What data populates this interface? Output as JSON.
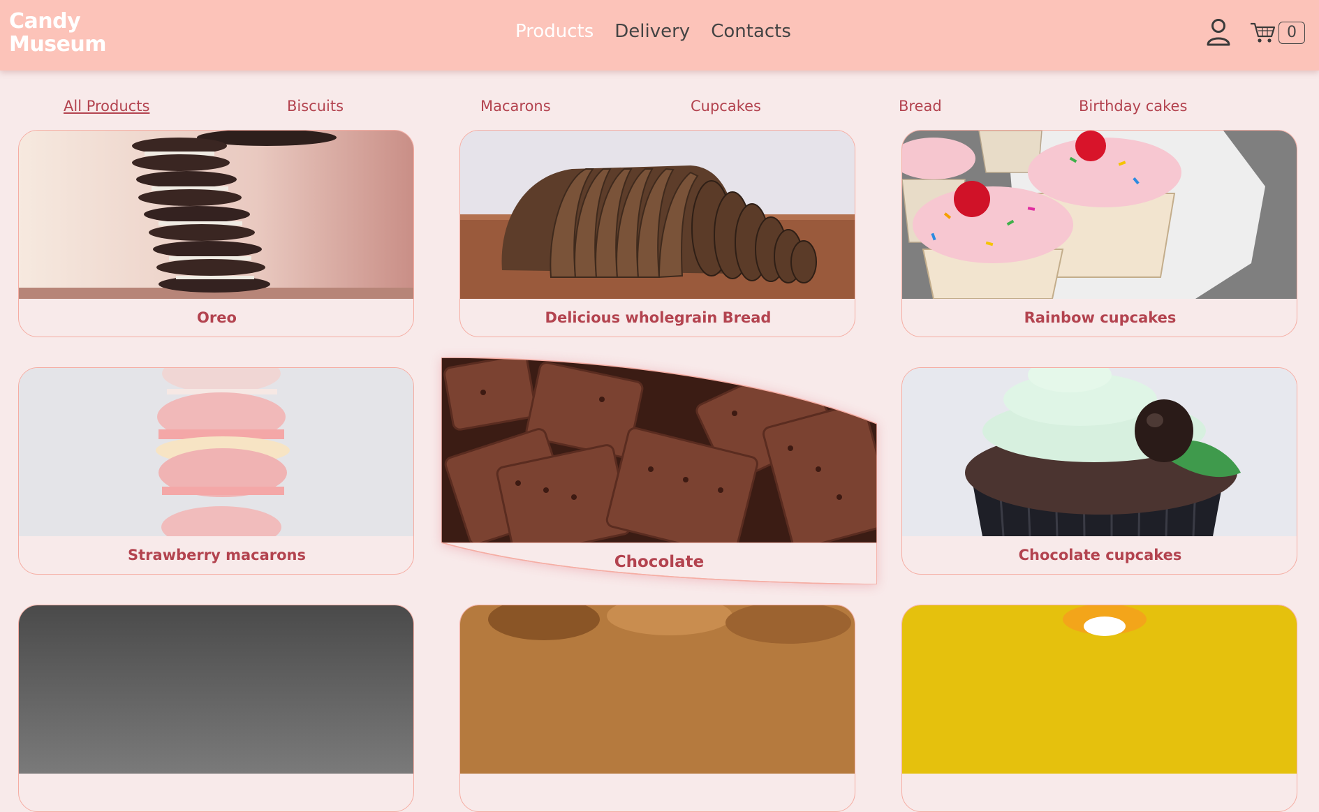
{
  "brand": {
    "line1": "Candy",
    "line2": "Museum"
  },
  "nav": [
    {
      "label": "Products",
      "active": true
    },
    {
      "label": "Delivery",
      "active": false
    },
    {
      "label": "Contacts",
      "active": false
    }
  ],
  "cart": {
    "count": "0"
  },
  "categories": [
    {
      "label": "All Products",
      "active": true
    },
    {
      "label": "Biscuits"
    },
    {
      "label": "Macarons"
    },
    {
      "label": "Cupcakes"
    },
    {
      "label": "Bread"
    },
    {
      "label": "Birthday cakes"
    }
  ],
  "products": [
    {
      "title": "Oreo"
    },
    {
      "title": "Delicious wholegrain Bread"
    },
    {
      "title": "Rainbow cupcakes"
    },
    {
      "title": "Strawberry macarons"
    },
    {
      "title": "Chocolate"
    },
    {
      "title": "Chocolate cupcakes"
    }
  ],
  "colors": {
    "header": "#fcc3b9",
    "page": "#f8eaea",
    "accent": "#b3434f",
    "border": "#f5ada3"
  }
}
